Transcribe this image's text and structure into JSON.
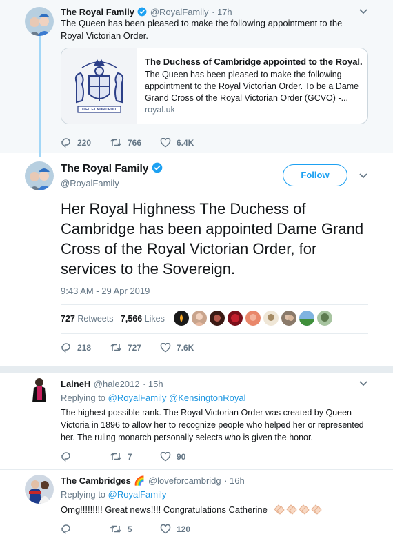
{
  "colors": {
    "accent": "#1da1f2",
    "link": "#1b95e0",
    "muted": "#657786",
    "text": "#14171a",
    "parent_bg": "#f5f8fa"
  },
  "parent_tweet": {
    "name": "The Royal Family",
    "handle": "@RoyalFamily",
    "time": "· 17h",
    "text": "The Queen has been pleased to make the following appointment to the Royal Victorian Order.",
    "card": {
      "title": "The Duchess of Cambridge appointed to the Royal...",
      "description": "The Queen has been pleased to make the following appointment to the Royal Victorian Order. To be a Dame Grand Cross of the Royal Victorian Order (GCVO) -...",
      "domain": "royal.uk",
      "image_text": "DIEU ET MON DROIT"
    },
    "replies": "220",
    "retweets": "766",
    "likes": "6.4K"
  },
  "main_tweet": {
    "name": "The Royal Family",
    "handle": "@RoyalFamily",
    "follow_label": "Follow",
    "text": "Her Royal Highness The Duchess of Cambridge has been appointed Dame Grand Cross of the Royal Victorian Order, for services to the Sovereign.",
    "timestamp": "9:43 AM - 29 Apr 2019",
    "retweet_count": "727",
    "retweet_label": "Retweets",
    "like_count": "7,566",
    "like_label": "Likes",
    "replies": "218",
    "retweets": "727",
    "likes": "7.6K"
  },
  "reply1": {
    "name": "LaineH",
    "handle": "@hale2012",
    "time": "· 15h",
    "replying_label": "Replying to",
    "replying_to": [
      "@RoyalFamily",
      "@KensingtonRoyal"
    ],
    "text": "The highest possible rank. The Royal Victorian Order was created by Queen Victoria in 1896 to allow her to recognize people who helped her or represented her. The ruling monarch personally selects who is given the honor.",
    "replies": "",
    "retweets": "7",
    "likes": "90"
  },
  "reply2": {
    "name": "The Cambridges",
    "name_emoji": "🌈",
    "handle": "@loveforcambridg",
    "time": "· 16h",
    "replying_label": "Replying to",
    "replying_to": [
      "@RoyalFamily"
    ],
    "text": "Omg!!!!!!!!! Great news!!!! Congratulations Catherine",
    "replies": "",
    "retweets": "5",
    "likes": "120"
  }
}
